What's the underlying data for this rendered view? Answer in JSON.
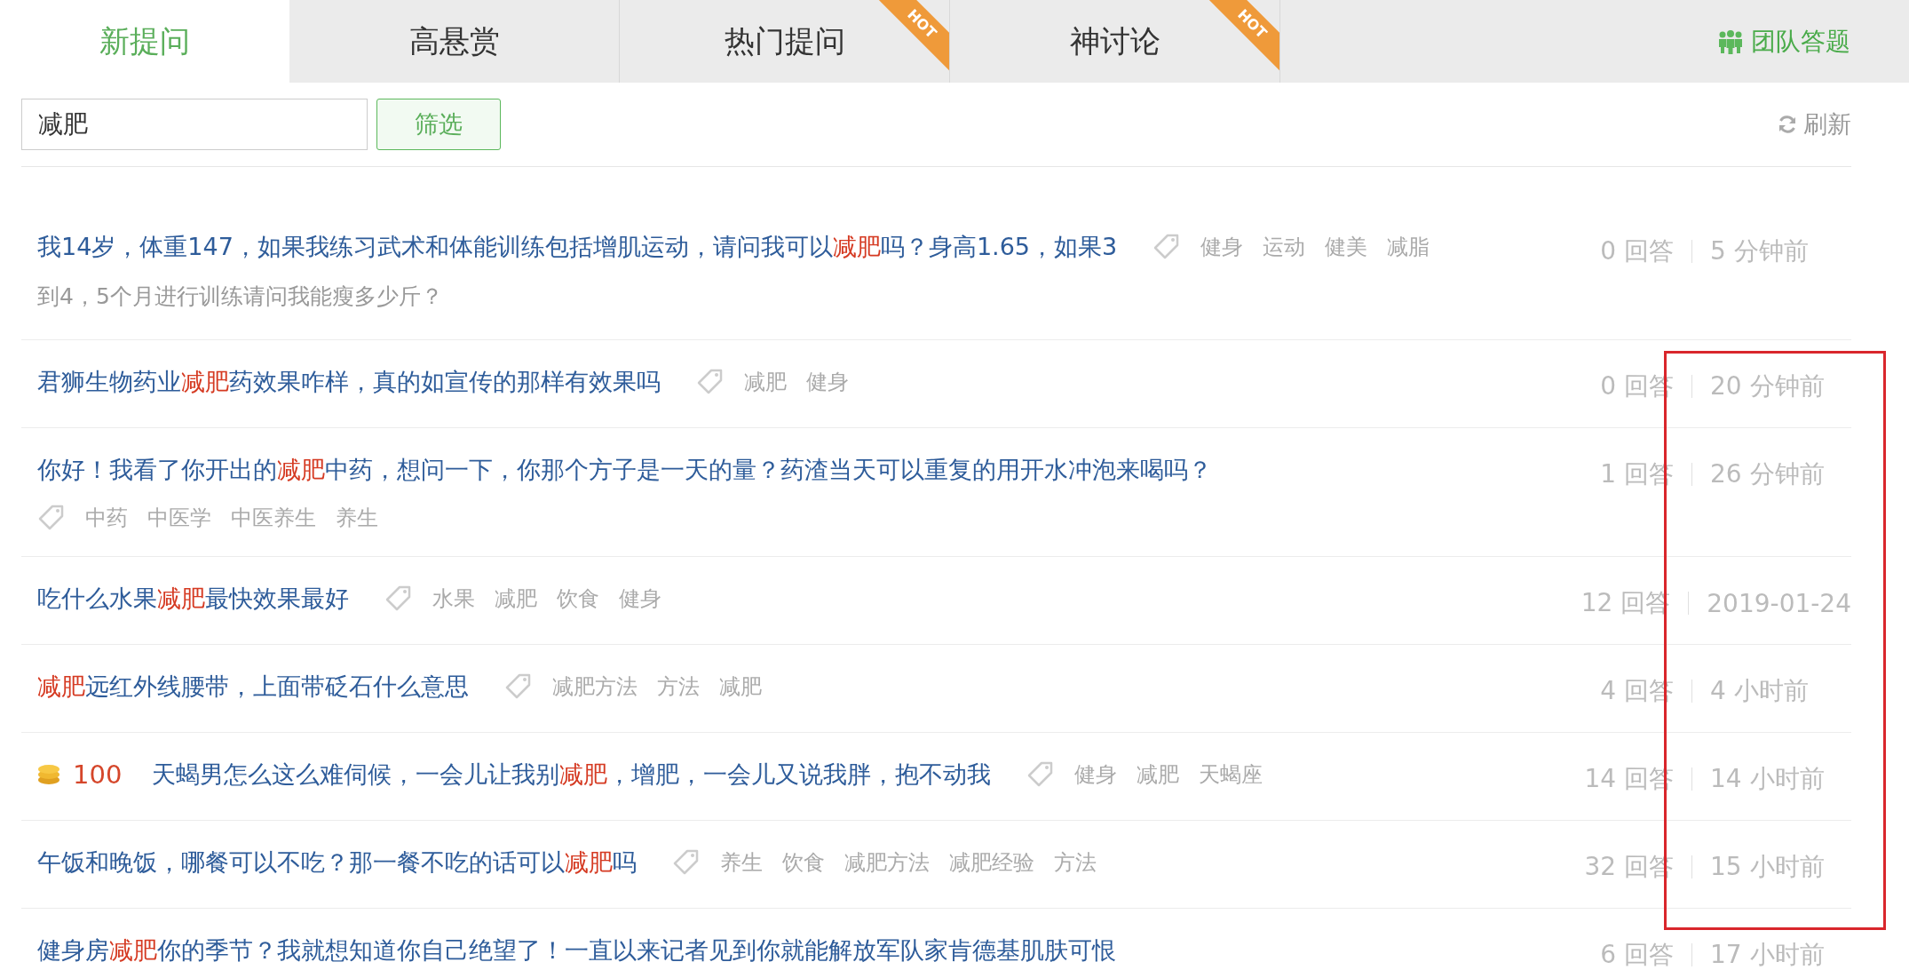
{
  "tabs": [
    {
      "label": "新提问",
      "selected": true
    },
    {
      "label": "高悬赏",
      "selected": false
    },
    {
      "label": "热门提问",
      "selected": false,
      "badge": "HOT"
    },
    {
      "label": "神讨论",
      "selected": false,
      "badge": "HOT"
    }
  ],
  "team_link": "团队答题",
  "filter": {
    "value": "减肥",
    "button": "筛选"
  },
  "refresh": "刷新",
  "questions": [
    {
      "title": [
        {
          "text": "我14岁，体重147，如果我练习武术和体能训练包括增肌运动，请问我可以",
          "highlight": false
        },
        {
          "text": "减肥",
          "highlight": true
        },
        {
          "text": "吗？身高1.65，如果3",
          "highlight": false
        }
      ],
      "description": "到4，5个月进行训练请问我能瘦多少斤？",
      "tags": [
        "健身",
        "运动",
        "健美",
        "减脂"
      ],
      "answers": "0 回答",
      "time": "5 分钟前"
    },
    {
      "title": [
        {
          "text": "君狮生物药业",
          "highlight": false
        },
        {
          "text": "减肥",
          "highlight": true
        },
        {
          "text": "药效果咋样，真的如宣传的那样有效果吗",
          "highlight": false
        }
      ],
      "tags": [
        "减肥",
        "健身"
      ],
      "answers": "0 回答",
      "time": "20 分钟前"
    },
    {
      "title": [
        {
          "text": "你好！我看了你开出的",
          "highlight": false
        },
        {
          "text": "减肥",
          "highlight": true
        },
        {
          "text": "中药，想问一下，你那个方子是一天的量？药渣当天可以重复的用开水冲泡来喝吗？",
          "highlight": false
        }
      ],
      "tags": [
        "中药",
        "中医学",
        "中医养生",
        "养生"
      ],
      "answers": "1 回答",
      "time": "26 分钟前"
    },
    {
      "title": [
        {
          "text": "吃什么水果",
          "highlight": false
        },
        {
          "text": "减肥",
          "highlight": true
        },
        {
          "text": "最快效果最好",
          "highlight": false
        }
      ],
      "tags": [
        "水果",
        "减肥",
        "饮食",
        "健身"
      ],
      "answers": "12 回答",
      "time": "2019-01-24"
    },
    {
      "title": [
        {
          "text": "减肥",
          "highlight": true
        },
        {
          "text": "远红外线腰带，上面带砭石什么意思",
          "highlight": false
        }
      ],
      "tags": [
        "减肥方法",
        "方法",
        "减肥"
      ],
      "answers": "4 回答",
      "time": "4 小时前"
    },
    {
      "reward": "100",
      "title": [
        {
          "text": "天蝎男怎么这么难伺候，一会儿让我别",
          "highlight": false
        },
        {
          "text": "减肥",
          "highlight": true
        },
        {
          "text": "，增肥，一会儿又说我胖，抱不动我",
          "highlight": false
        }
      ],
      "tags": [
        "健身",
        "减肥",
        "天蝎座"
      ],
      "answers": "14 回答",
      "time": "14 小时前"
    },
    {
      "title": [
        {
          "text": "午饭和晚饭，哪餐可以不吃？那一餐不吃的话可以",
          "highlight": false
        },
        {
          "text": "减肥",
          "highlight": true
        },
        {
          "text": "吗",
          "highlight": false
        }
      ],
      "tags": [
        "养生",
        "饮食",
        "减肥方法",
        "减肥经验",
        "方法"
      ],
      "answers": "32 回答",
      "time": "15 小时前"
    },
    {
      "title": [
        {
          "text": "健身房",
          "highlight": false
        },
        {
          "text": "减肥",
          "highlight": true
        },
        {
          "text": "你的季节？我就想知道你自己绝望了！一直以来记者见到你就能解放军队家肯德基肌肤可恨",
          "highlight": false
        }
      ],
      "answers": "6 回答",
      "time": "17 小时前"
    }
  ],
  "annotation_frame": {
    "shown": true
  }
}
